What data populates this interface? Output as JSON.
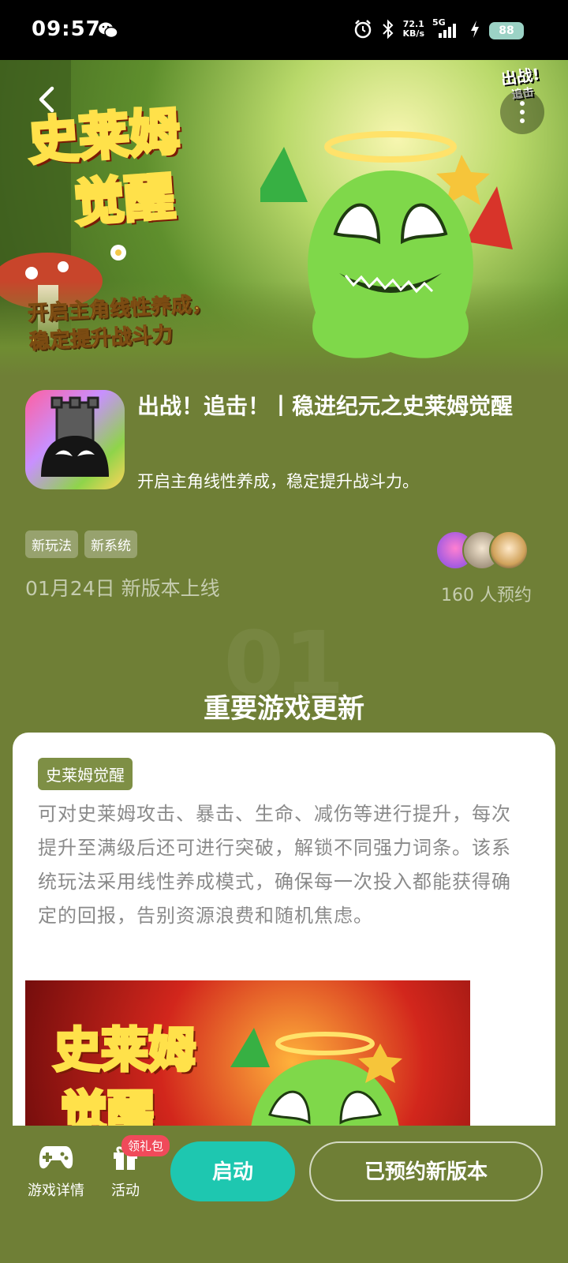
{
  "status_bar": {
    "time": "09:57",
    "net_speed_value": "72.1",
    "net_speed_unit": "KB/s",
    "network": "5G",
    "battery": "88"
  },
  "hero": {
    "title_line1": "史莱姆",
    "title_line2": "觉醒",
    "tagline_line1": "开启主角线性养成，",
    "tagline_line2": "稳定提升战斗力",
    "brand_line1": "出战!",
    "brand_line2": "追击"
  },
  "app": {
    "title": "出战！追击！丨稳进纪元之史莱姆觉醒",
    "subtitle": "开启主角线性养成，稳定提升战斗力。",
    "tags": [
      "新玩法",
      "新系统"
    ],
    "release_text": "01月24日 新版本上线",
    "reserve_count": "160 人预约"
  },
  "section": {
    "number": "01",
    "title": "重要游戏更新"
  },
  "card": {
    "label": "史莱姆觉醒",
    "description": "可对史莱姆攻击、暴击、生命、减伤等进行提升，每次提升至满级后还可进行突破，解锁不同强力词条。该系统玩法采用线性养成模式，确保每一次投入都能获得确定的回报，告别资源浪费和随机焦虑。",
    "image_title_line1": "史莱姆",
    "image_title_line2": "觉醒"
  },
  "bottom_bar": {
    "game_details": "游戏详情",
    "activity": "活动",
    "gift_badge": "领礼包",
    "launch": "启动",
    "reserved": "已预约新版本"
  },
  "colors": {
    "page_bg": "#6f7f36",
    "launch_button": "#1ec7b0",
    "badge": "#f04a5a",
    "tag_pill": "#7e8f45"
  }
}
